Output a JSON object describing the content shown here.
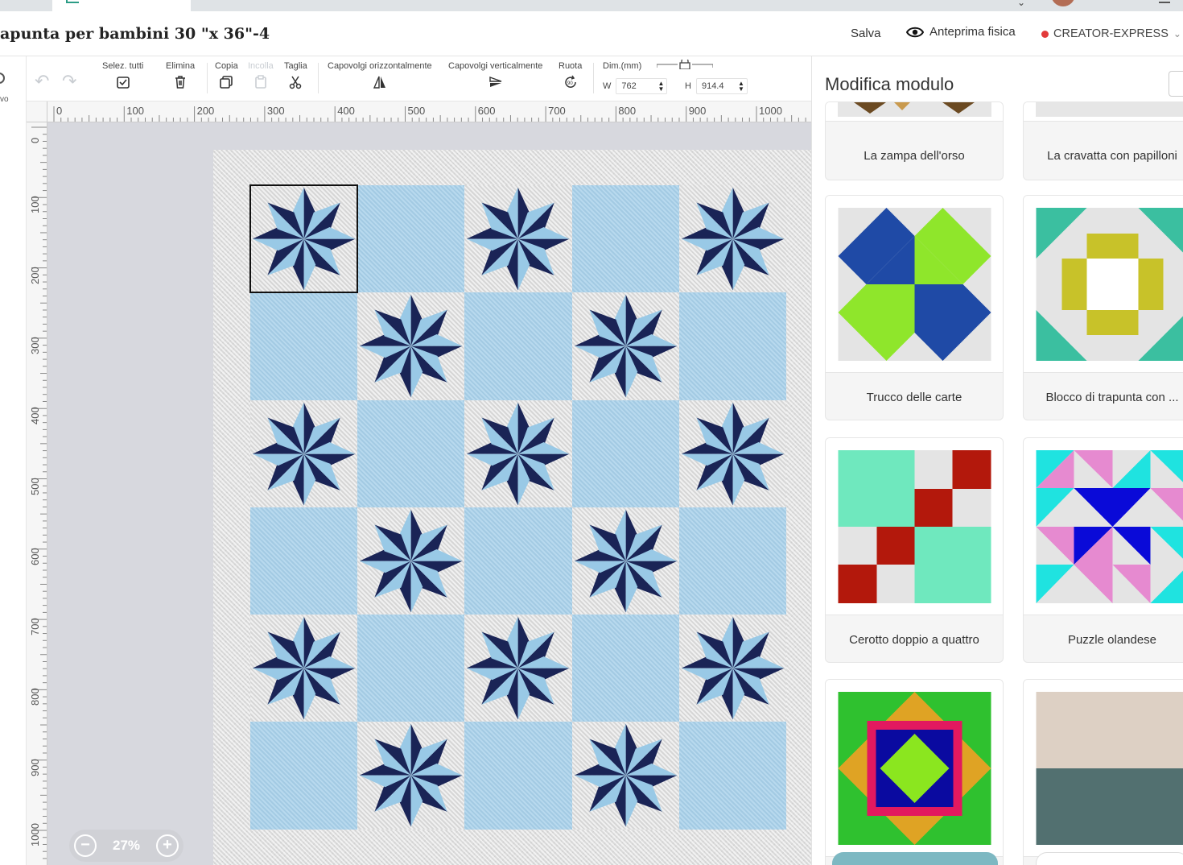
{
  "header": {
    "doc_title": "apunta per bambini 30 \"x 36\"-4",
    "save": "Salva",
    "preview": "Anteprima fisica",
    "machine": "CREATOR-EXPRESS"
  },
  "leftbar": {
    "label": "vo"
  },
  "toolbar": {
    "select_all": "Selez. tutti",
    "delete": "Elimina",
    "copy": "Copia",
    "paste": "Incolla",
    "cut": "Taglia",
    "flip_h": "Capovolgi orizzontalmente",
    "flip_v": "Capovolgi verticalmente",
    "rotate": "Ruota",
    "dim_label": "Dim.(mm)",
    "w_label": "W",
    "w_value": "762",
    "h_label": "H",
    "h_value": "914.4"
  },
  "ruler": {
    "top": [
      "0",
      "100",
      "200",
      "300",
      "400",
      "500",
      "600",
      "700",
      "800",
      "900",
      "1000"
    ],
    "left": [
      "0",
      "100",
      "200",
      "300",
      "400",
      "500",
      "600",
      "700",
      "800",
      "900",
      "1000"
    ]
  },
  "zoom": {
    "value": "27%"
  },
  "panel": {
    "title": "Modifica modulo",
    "cards": [
      "La zampa dell'orso",
      "La cravatta con papilloni",
      "Trucco delle carte",
      "Blocco di trapunta con ...",
      "Cerotto doppio a quattro",
      "Puzzle olandese"
    ]
  },
  "colors": {
    "star_dark": "#1a2456",
    "star_light": "#99c9e6",
    "plain_block": "#a8d1ea",
    "machine_dot": "#e23a3a"
  }
}
